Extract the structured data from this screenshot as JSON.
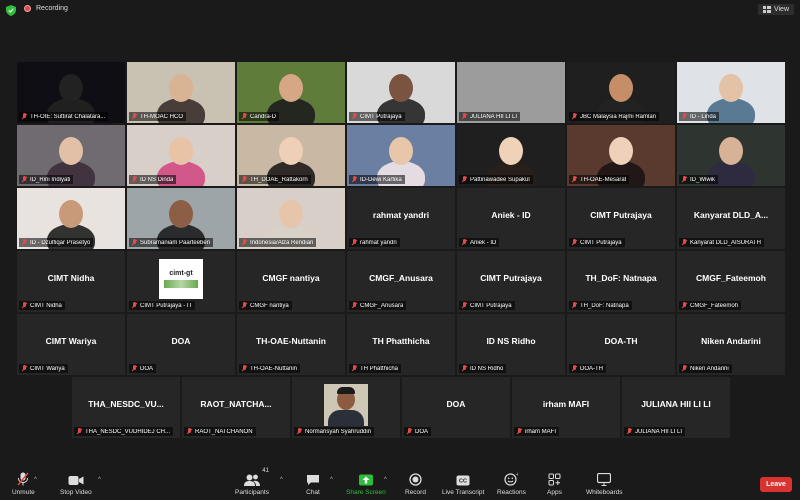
{
  "topbar": {
    "recording_label": "Recording",
    "view_label": "View"
  },
  "tiles": [
    {
      "label": "TH-OIE: Suttirat  Chalatara...",
      "type": "video",
      "bg": "#0e0e14",
      "hair": "#222",
      "skin": "#222"
    },
    {
      "label": "TH-MOAC HCO",
      "type": "video",
      "bg": "#c9c2b2",
      "hair": "#3a2f2a",
      "skin": "#d8b394"
    },
    {
      "label": "Candra-D",
      "type": "video",
      "bg": "#5f7c3a",
      "hair": "#1e1e1e",
      "skin": "#d5a784"
    },
    {
      "label": "CIMT Putrajaya",
      "type": "video",
      "bg": "#d9d9d9",
      "hair": "#222",
      "skin": "#7a5440",
      "active": true
    },
    {
      "label": "JULIANA HII LI LI",
      "type": "video",
      "bg": "#9c9c9c",
      "hair": "#9c9c9c",
      "skin": "#9c9c9c"
    },
    {
      "label": "JBC Malaysia Rajmi Ramlan",
      "type": "video",
      "bg": "#1f1f1f",
      "hair": "#222",
      "skin": "#c68e67"
    },
    {
      "label": "ID - Linda",
      "type": "video",
      "bg": "#dfe2e6",
      "hair": "#4a6f88",
      "skin": "#e4c2a5"
    },
    {
      "label": "ID_Rini Indiyati",
      "type": "video",
      "bg": "#6f6b70",
      "hair": "#3d2e3b",
      "skin": "#e2c0a8"
    },
    {
      "label": "ID NS Dinda",
      "type": "video",
      "bg": "#d8cfc9",
      "hair": "#d24a82",
      "skin": "#e8c3a5"
    },
    {
      "label": "TH_DOAE_Rattakorn",
      "type": "video",
      "bg": "#c9b8a3",
      "hair": "#1e1a1a",
      "skin": "#eecfb7"
    },
    {
      "label": "ID-Dewi Kartika",
      "type": "video",
      "bg": "#6b7fa2",
      "hair": "#f2e6ea",
      "skin": "#e7c6aa"
    },
    {
      "label": "Pattinawadee Supakul",
      "type": "video",
      "bg": "#1f1f1f",
      "hair": "#2a1f1a",
      "skin": "#f0d2b8"
    },
    {
      "label": "TH-OAE-Mesarat",
      "type": "video",
      "bg": "#5a3a2e",
      "hair": "#1b1414",
      "skin": "#efd0b9"
    },
    {
      "label": "ID_Wiwik",
      "type": "video",
      "bg": "#2e3530",
      "hair": "#2f2a44",
      "skin": "#d8b297"
    },
    {
      "label": "ID - Dzulfiqar Prasetyo",
      "type": "video",
      "bg": "#e9e3e0",
      "hair": "#1e1e1e",
      "skin": "#c89a7a"
    },
    {
      "label": "Subramaniam Paarteeben",
      "type": "video",
      "bg": "#9da5a9",
      "hair": "#1e1e1e",
      "skin": "#8c5e45"
    },
    {
      "label": "Indonesia/Alza Rendian",
      "type": "video",
      "bg": "#d8d0c8",
      "hair": "#d8d0c8",
      "skin": "#e6c5ab"
    },
    {
      "label": "rahmat yandri",
      "name": "rahmat yandri",
      "type": "name"
    },
    {
      "label": "Aniek - ID",
      "name": "Aniek - ID",
      "type": "name"
    },
    {
      "label": "CIMT Putrajaya",
      "name": "CIMT Putrajaya",
      "type": "name"
    },
    {
      "label": "Kanyarat DLD_AISURATH",
      "name": "Kanyarat DLD_A...",
      "type": "name"
    },
    {
      "label": "CIMT Nidha",
      "name": "CIMT Nidha",
      "type": "name"
    },
    {
      "label": "CIMT Putrajaya - IT",
      "type": "logo",
      "logo_text": "cimt-gt"
    },
    {
      "label": "CMGF nantiya",
      "name": "CMGF nantiya",
      "type": "name"
    },
    {
      "label": "CMGF_Anusara",
      "name": "CMGF_Anusara",
      "type": "name"
    },
    {
      "label": "CIMT Putrajaya",
      "name": "CIMT Putrajaya",
      "type": "name"
    },
    {
      "label": "TH_DoF: Natnapa",
      "name": "TH_DoF: Natnapa",
      "type": "name"
    },
    {
      "label": "CMGF_Fateemoh",
      "name": "CMGF_Fateemoh",
      "type": "name"
    },
    {
      "label": "CIMT Wariya",
      "name": "CIMT Wariya",
      "type": "name"
    },
    {
      "label": "DOA",
      "name": "DOA",
      "type": "name"
    },
    {
      "label": "TH-OAE-Nuttanin",
      "name": "TH-OAE-Nuttanin",
      "type": "name"
    },
    {
      "label": "TH Phatthicha",
      "name": "TH Phatthicha",
      "type": "name"
    },
    {
      "label": "ID NS Ridho",
      "name": "ID NS Ridho",
      "type": "name"
    },
    {
      "label": "DOA-TH",
      "name": "DOA-TH",
      "type": "name"
    },
    {
      "label": "Niken Andarini",
      "name": "Niken Andarini",
      "type": "name"
    },
    {
      "label": "THA_NESDC_VUDHIDEJ CH...",
      "name": "THA_NESDC_VU...",
      "type": "name"
    },
    {
      "label": "RAOT_NATCHANON",
      "name": "RAOT_NATCHA...",
      "type": "name"
    },
    {
      "label": "Normansyah Syahruddin",
      "type": "photo"
    },
    {
      "label": "DOA",
      "name": "DOA",
      "type": "name"
    },
    {
      "label": "irham MAFI",
      "name": "irham MAFI",
      "type": "name"
    },
    {
      "label": "JULIANA HII LI LI",
      "name": "JULIANA HII LI LI",
      "type": "name"
    }
  ],
  "toolbar": {
    "unmute": "Unmute",
    "stop_video": "Stop Video",
    "participants": "Participants",
    "participants_count": "41",
    "chat": "Chat",
    "share_screen": "Share Screen",
    "record": "Record",
    "live_transcript": "Live Transcript",
    "reactions": "Reactions",
    "apps": "Apps",
    "whiteboards": "Whiteboards",
    "leave": "Leave"
  },
  "colors": {
    "accent_green": "#2fbd3b",
    "active_speaker": "#b5e61d",
    "leave_red": "#d9322f"
  }
}
